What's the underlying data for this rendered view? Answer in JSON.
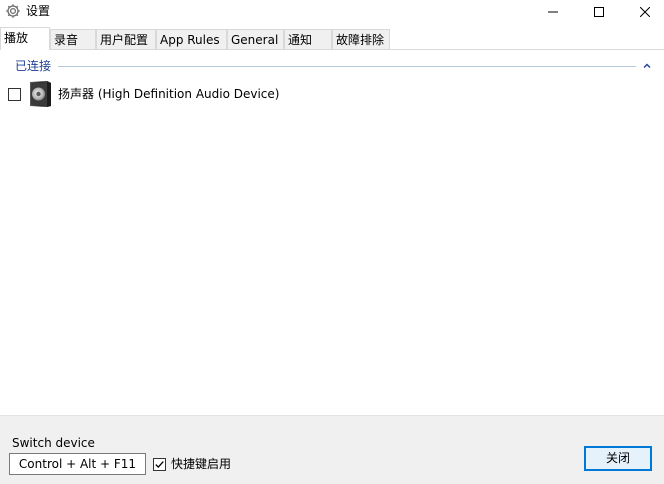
{
  "window": {
    "title": "设置",
    "controls": {
      "minimize_icon": "minimize-icon",
      "maximize_icon": "maximize-icon",
      "close_icon": "close-icon"
    }
  },
  "tabs": [
    {
      "label": "播放",
      "active": true
    },
    {
      "label": "录音",
      "active": false
    },
    {
      "label": "用户配置",
      "active": false
    },
    {
      "label": "App Rules",
      "active": false
    },
    {
      "label": "General",
      "active": false
    },
    {
      "label": "通知",
      "active": false
    },
    {
      "label": "故障排除",
      "active": false
    }
  ],
  "group": {
    "title": "已连接",
    "collapse_icon": "chevron-up-icon"
  },
  "devices": [
    {
      "label": "扬声器 (High Definition Audio Device)",
      "checked": false,
      "icon": "speaker-icon"
    }
  ],
  "bottom": {
    "switch_label": "Switch device",
    "hotkey_value": "Control + Alt + F11",
    "hotkey_enabled_label": "快捷键启用",
    "hotkey_enabled": true,
    "close_button": "关闭"
  },
  "colors": {
    "accent": "#0078d7",
    "group_title": "#1e3f93",
    "panel_bg": "#f0f0f0"
  }
}
